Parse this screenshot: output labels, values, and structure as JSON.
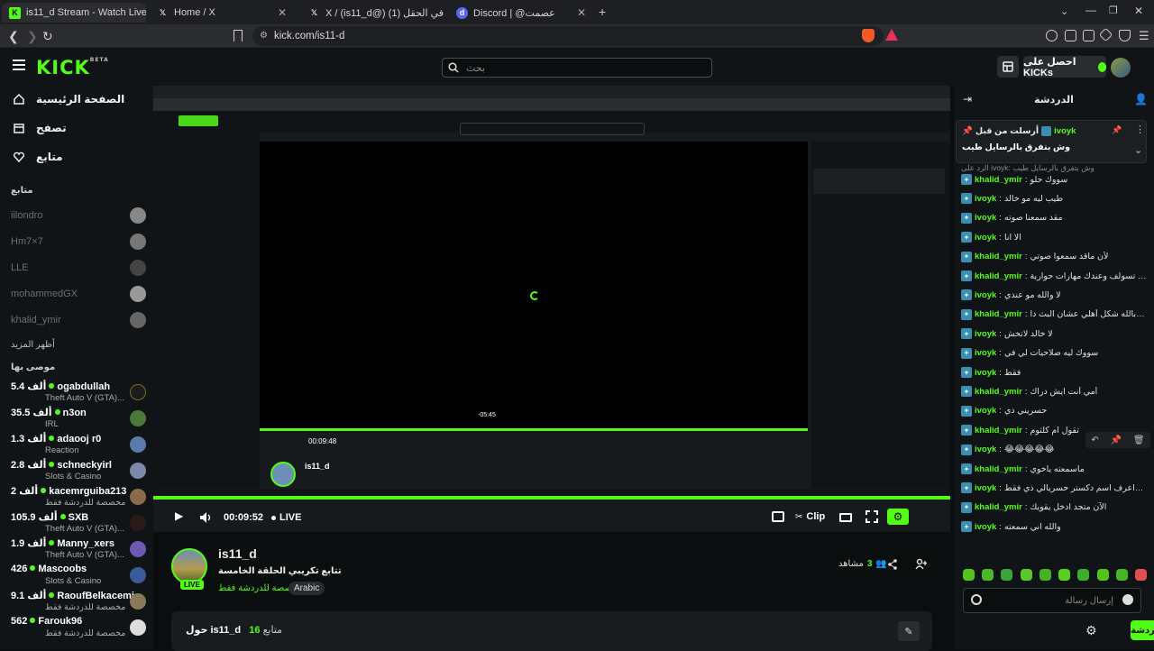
{
  "browser": {
    "tabs": [
      {
        "title": "is11_d Stream - Watch Live on K",
        "icon": "kick-icon",
        "active": true
      },
      {
        "title": "Home / X",
        "icon": "x-icon"
      },
      {
        "title": "X / (is11_d@) سعد | في الحقل (1)",
        "icon": "x-icon"
      },
      {
        "title": "Discord | @عصمت",
        "icon": "discord-icon"
      }
    ],
    "url": "kick.com/is11-d"
  },
  "header": {
    "logo": "KICK",
    "logo_sup": "BETA",
    "search_placeholder": "بحث",
    "get_kicks": "احصل على KICKs"
  },
  "sidebar": {
    "nav": [
      {
        "label": "الصفحة الرئيسية",
        "icon": "home-icon"
      },
      {
        "label": "تصفح",
        "icon": "browse-icon"
      },
      {
        "label": "متابع",
        "icon": "heart-icon"
      }
    ],
    "following_title": "متابع",
    "following": [
      "iilondro",
      "Hm7×7",
      "LLE",
      "mohammedGX",
      "khalid_ymir"
    ],
    "show_more": "أظهر المزيد",
    "recommended_title": "موصى بها",
    "recommended": [
      {
        "viewers": "5.4",
        "unit": "ألف",
        "name": "ogabdullah",
        "category": "Theft Auto V (GTA)..."
      },
      {
        "viewers": "35.5",
        "unit": "ألف",
        "name": "n3on",
        "category": "IRL"
      },
      {
        "viewers": "1.3",
        "unit": "ألف",
        "name": "adaooj r0",
        "category": "Reaction"
      },
      {
        "viewers": "2.8",
        "unit": "ألف",
        "name": "schneckyirl",
        "category": "Slots & Casino"
      },
      {
        "viewers": "2",
        "unit": "ألف",
        "name": "kacemrguiba213",
        "category": "مخصصة للدردشة فقط"
      },
      {
        "viewers": "105.9",
        "unit": "ألف",
        "name": "SXB",
        "category": "Theft Auto V (GTA)..."
      },
      {
        "viewers": "1.9",
        "unit": "ألف",
        "name": "Manny_xers",
        "category": "Theft Auto V (GTA)..."
      },
      {
        "viewers": "426",
        "unit": "",
        "name": "Mascoobs",
        "category": "Slots & Casino"
      },
      {
        "viewers": "9.1",
        "unit": "ألف",
        "name": "RaoufBelkacemi",
        "category": "مخصصة للدردشة فقط"
      },
      {
        "viewers": "562",
        "unit": "",
        "name": "Farouk96",
        "category": "مخصصة للدردشة فقط"
      }
    ]
  },
  "player": {
    "time": "00:09:52",
    "live": "LIVE",
    "clip": "Clip",
    "inner_time": "00:09:48",
    "inner_seek": "-05:45"
  },
  "stream": {
    "name": "is11_d",
    "title": "تتابع تكريبي الحلقة الخامسة",
    "category": "مخصصة للدردشة فقط",
    "language": "Arabic",
    "live_badge": "LIVE",
    "viewers": "3",
    "viewers_label": "مشاهد",
    "about_prefix": "حول",
    "about_name": "is11_d",
    "followers": "16",
    "followers_label": "متابع"
  },
  "chat": {
    "title": "الدردشة",
    "pinned_user": "ivoyk",
    "pinned_by": "أرسلت من قبل",
    "pinned_text": "وش بتفرق بالرسايل طيب",
    "reply_hint": "الرد على ivoyk: وش بتفرق بالرسايل طيب",
    "messages": [
      {
        "user": "khalid_ymir",
        "text": "سووك حلو"
      },
      {
        "user": "ivoyk",
        "text": "طيب ليه مو خالد"
      },
      {
        "user": "ivoyk",
        "text": "مقد سمعنا صوته"
      },
      {
        "user": "ivoyk",
        "text": "الا انا"
      },
      {
        "user": "khalid_ymir",
        "text": "لأن ماقد سمعوا صوتي"
      },
      {
        "user": "khalid_ymir",
        "text": "أنت تسولف وعندك مهارات حوارية"
      },
      {
        "user": "ivoyk",
        "text": "لا والله مو عندي"
      },
      {
        "user": "khalid_ymir",
        "text": "منهههههههههههههههه أقسم بالله شكل أهلي عشان البث دا"
      },
      {
        "user": "ivoyk",
        "text": "لا خالد لاتخش"
      },
      {
        "user": "ivoyk",
        "text": "سووك ليه صلاحيات لي في"
      },
      {
        "user": "ivoyk",
        "text": "فقط"
      },
      {
        "user": "khalid_ymir",
        "text": "أمي أنت ايش دراك"
      },
      {
        "user": "ivoyk",
        "text": "حسريني ذي"
      },
      {
        "user": "khalid_ymir",
        "text": "تقول ام كلثوم"
      },
      {
        "user": "ivoyk",
        "text": "😂😂😂😂😂"
      },
      {
        "user": "khalid_ymir",
        "text": "ماسمعته ياخوي"
      },
      {
        "user": "ivoyk",
        "text": "سمعت صوت خالد واعرف اسم دكستر حسريالي ذي فقط"
      },
      {
        "user": "khalid_ymir",
        "text": "الآن متجد ادخل يقويك"
      },
      {
        "user": "ivoyk",
        "text": "والله اني سمعته"
      }
    ],
    "input_placeholder": "إرسال رسالة",
    "send": "الدردشة"
  }
}
